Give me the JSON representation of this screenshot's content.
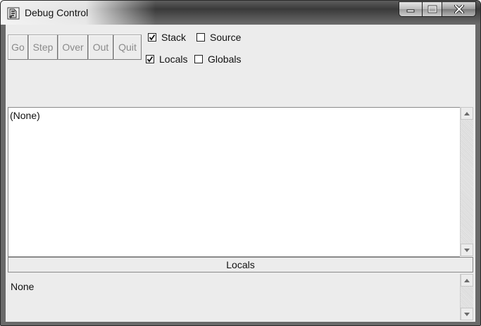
{
  "window": {
    "title": "Debug Control",
    "icons": {
      "app": "python-feather-icon",
      "minimize": "minimize-icon",
      "maximize": "maximize-icon",
      "close": "close-icon"
    }
  },
  "toolbar": {
    "go_label": "Go",
    "step_label": "Step",
    "over_label": "Over",
    "out_label": "Out",
    "quit_label": "Quit"
  },
  "options": {
    "stack": {
      "label": "Stack",
      "checked": true
    },
    "source": {
      "label": "Source",
      "checked": false
    },
    "locals": {
      "label": "Locals",
      "checked": true
    },
    "globals": {
      "label": "Globals",
      "checked": false
    }
  },
  "stack_pane": {
    "text": "(None)"
  },
  "locals_section": {
    "header": "Locals",
    "text": "None"
  }
}
